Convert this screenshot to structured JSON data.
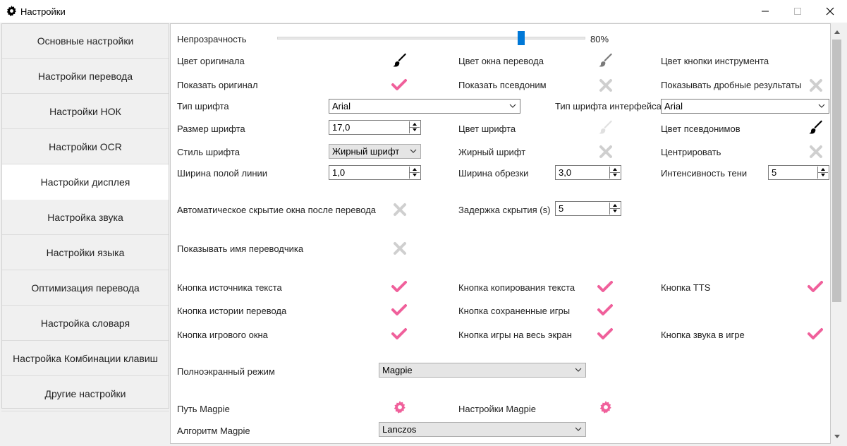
{
  "window": {
    "title": "Настройки"
  },
  "sidebar": {
    "items": [
      {
        "label": "Основные настройки"
      },
      {
        "label": "Настройки перевода"
      },
      {
        "label": "Настройки НОК"
      },
      {
        "label": "Настройки OCR"
      },
      {
        "label": "Настройки дисплея",
        "active": true
      },
      {
        "label": "Настройка звука"
      },
      {
        "label": "Настройки языка"
      },
      {
        "label": "Оптимизация перевода"
      },
      {
        "label": "Настройка словаря"
      },
      {
        "label": "Настройка Комбинации клавиш"
      },
      {
        "label": "Другие настройки"
      }
    ]
  },
  "settings": {
    "opacity": {
      "label": "Непрозрачность",
      "value": 80,
      "value_text": "80%"
    },
    "original_color": {
      "label": "Цвет оригинала",
      "color": "#000000"
    },
    "window_color": {
      "label": "Цвет окна перевода",
      "color": "#7a7a7a"
    },
    "tool_button_color": {
      "label": "Цвет кнопки инструмента"
    },
    "show_original": {
      "label": "Показать оригинал",
      "checked": true
    },
    "show_alias": {
      "label": "Показать псевдоним",
      "checked": false
    },
    "show_fraction": {
      "label": "Показывать дробные результаты",
      "checked": false
    },
    "font_type": {
      "label": "Тип шрифта",
      "value": "Arial"
    },
    "ui_font_type": {
      "label": "Тип шрифта интерфейса",
      "value": "Arial"
    },
    "font_size": {
      "label": "Размер шрифта",
      "value": "17,0"
    },
    "font_color": {
      "label": "Цвет шрифта",
      "color": "#e0e0e0"
    },
    "alias_color": {
      "label": "Цвет псевдонимов",
      "color": "#000000"
    },
    "font_style": {
      "label": "Стиль шрифта",
      "value": "Жирный шрифт"
    },
    "bold_font": {
      "label": "Жирный шрифт",
      "checked": false
    },
    "center": {
      "label": "Центрировать",
      "checked": false
    },
    "hollow_width": {
      "label": "Ширина полой линии",
      "value": "1,0"
    },
    "trim_width": {
      "label": "Ширина обрезки",
      "value": "3,0"
    },
    "shadow_intensity": {
      "label": "Интенсивность тени",
      "value": "5"
    },
    "auto_hide": {
      "label": "Автоматическое скрытие окна после перевода",
      "checked": false
    },
    "hide_delay": {
      "label": "Задержка скрытия (s)",
      "value": "5"
    },
    "show_translator": {
      "label": "Показывать имя переводчика",
      "checked": false
    },
    "source_text_btn": {
      "label": "Кнопка источника текста",
      "checked": true
    },
    "copy_text_btn": {
      "label": "Кнопка копирования текста",
      "checked": true
    },
    "tts_btn": {
      "label": "Кнопка TTS",
      "checked": true
    },
    "history_btn": {
      "label": "Кнопка истории перевода",
      "checked": true
    },
    "saved_games_btn": {
      "label": "Кнопка сохраненные игры",
      "checked": true
    },
    "game_window_btn": {
      "label": "Кнопка игрового окна",
      "checked": true
    },
    "fullscreen_game_btn": {
      "label": "Кнопка игры на весь экран",
      "checked": true
    },
    "game_sound_btn": {
      "label": "Кнопка звука в игре",
      "checked": true
    },
    "fullscreen_mode": {
      "label": "Полноэкранный режим",
      "value": "Magpie"
    },
    "magpie_path": {
      "label": "Путь Magpie"
    },
    "magpie_settings": {
      "label": "Настройки Magpie"
    },
    "magpie_algorithm": {
      "label": "Алгоритм Magpie",
      "value": "Lanczos"
    }
  },
  "colors": {
    "accent": "#f0609b",
    "slider": "#0078d7",
    "off": "#cfcfcf"
  }
}
